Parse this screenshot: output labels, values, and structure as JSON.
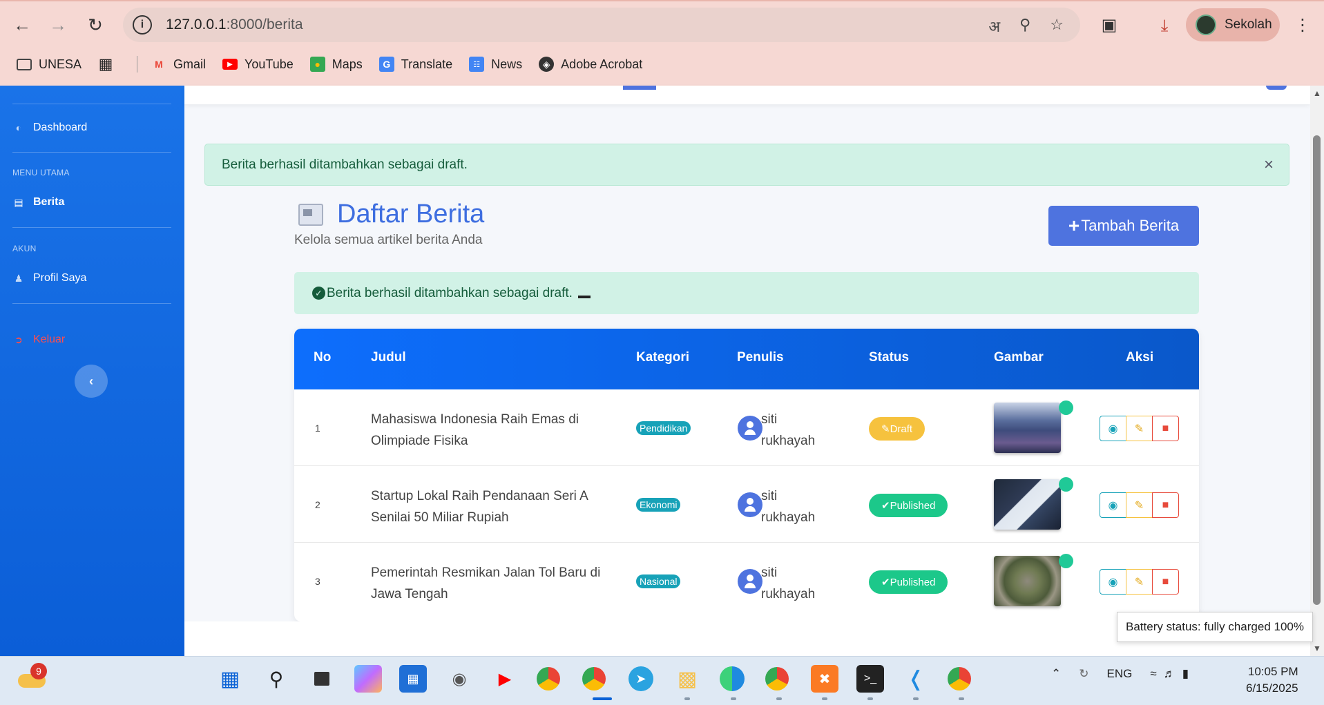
{
  "browser": {
    "url_host": "127.0.0.1",
    "url_rest": ":8000/berita",
    "profile_name": "Sekolah",
    "bookmarks": [
      {
        "label": "UNESA",
        "icon": "folder-icon"
      },
      {
        "label": "Gmail",
        "icon": "gmail-icon",
        "color": "#ea4335"
      },
      {
        "label": "YouTube",
        "icon": "youtube-icon",
        "color": "#ff0000"
      },
      {
        "label": "Maps",
        "icon": "maps-icon",
        "color": "#34a853"
      },
      {
        "label": "Translate",
        "icon": "translate-icon",
        "color": "#4285f4"
      },
      {
        "label": "News",
        "icon": "news-icon",
        "color": "#4285f4"
      },
      {
        "label": "Adobe Acrobat",
        "icon": "globe-icon",
        "color": "#333333"
      }
    ]
  },
  "sidebar": {
    "items": [
      {
        "label": "Dashboard",
        "icon": "gauge-icon"
      },
      {
        "label": "Berita",
        "icon": "newspaper-icon",
        "active": true
      },
      {
        "label": "Profil Saya",
        "icon": "user-icon"
      },
      {
        "label": "Keluar",
        "icon": "logout-icon",
        "color": "#ff4d4d"
      }
    ],
    "headings": [
      "MENU UTAMA",
      "AKUN"
    ]
  },
  "alerts": {
    "top": "Berita berhasil ditambahkan sebagai draft.",
    "inline": "Berita berhasil ditambahkan sebagai draft."
  },
  "page": {
    "title": "Daftar Berita",
    "subtitle": "Kelola semua artikel berita Anda",
    "add_button": "Tambah Berita"
  },
  "table": {
    "headers": [
      "No",
      "Judul",
      "Kategori",
      "Penulis",
      "Status",
      "Gambar",
      "Aksi"
    ],
    "rows": [
      {
        "no": "1",
        "title": "Mahasiswa Indonesia Raih Emas di Olimpiade Fisika",
        "category": "Pendidikan",
        "author": "siti rukhayah",
        "status": "Draft",
        "status_color": "#f6c23e"
      },
      {
        "no": "2",
        "title": "Startup Lokal Raih Pendanaan Seri A Senilai 50 Miliar Rupiah",
        "category": "Ekonomi",
        "author": "siti rukhayah",
        "status": "Published",
        "status_color": "#1cc88a"
      },
      {
        "no": "3",
        "title": "Pemerintah Resmikan Jalan Tol Baru di Jawa Tengah",
        "category": "Nasional",
        "author": "siti rukhayah",
        "status": "Published",
        "status_color": "#1cc88a"
      }
    ]
  },
  "tooltip": {
    "battery": "Battery status: fully charged 100%"
  },
  "taskbar": {
    "weather_badge": "9",
    "lang": "ENG",
    "time": "10:05 PM",
    "date": "6/15/2025"
  }
}
